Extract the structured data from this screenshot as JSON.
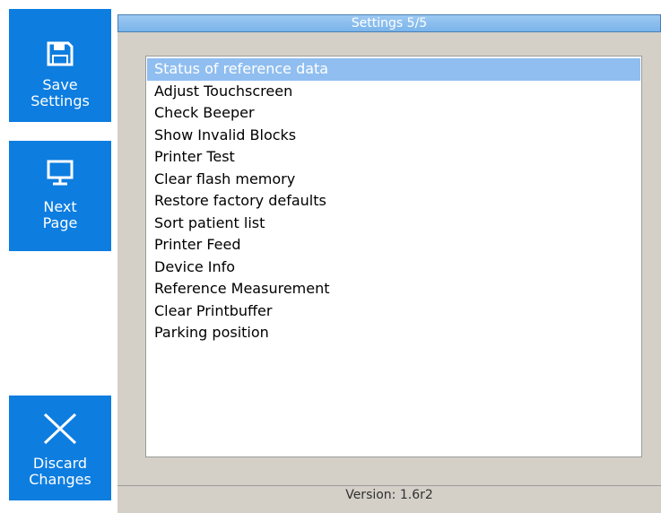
{
  "sidebar": {
    "save": {
      "line1": "Save",
      "line2": "Settings",
      "icon": "floppy-disk-icon"
    },
    "next": {
      "line1": "Next",
      "line2": "Page",
      "icon": "monitor-icon"
    },
    "discard": {
      "line1": "Discard",
      "line2": "Changes",
      "icon": "close-x-icon"
    }
  },
  "header": {
    "title": "Settings 5/5"
  },
  "list": {
    "selected_index": 0,
    "items": [
      "Status of reference data",
      "Adjust Touchscreen",
      "Check Beeper",
      "Show Invalid Blocks",
      "Printer Test",
      "Clear flash memory",
      "Restore factory defaults",
      "Sort patient list",
      "Printer Feed",
      "Device Info",
      "Reference Measurement",
      "Clear Printbuffer",
      "Parking position"
    ]
  },
  "footer": {
    "version": "Version: 1.6r2"
  },
  "colors": {
    "button_blue": "#0d7de0",
    "title_blue": "#8cbfef",
    "selection_blue": "#90bef0",
    "panel_gray": "#d4d0c8"
  }
}
